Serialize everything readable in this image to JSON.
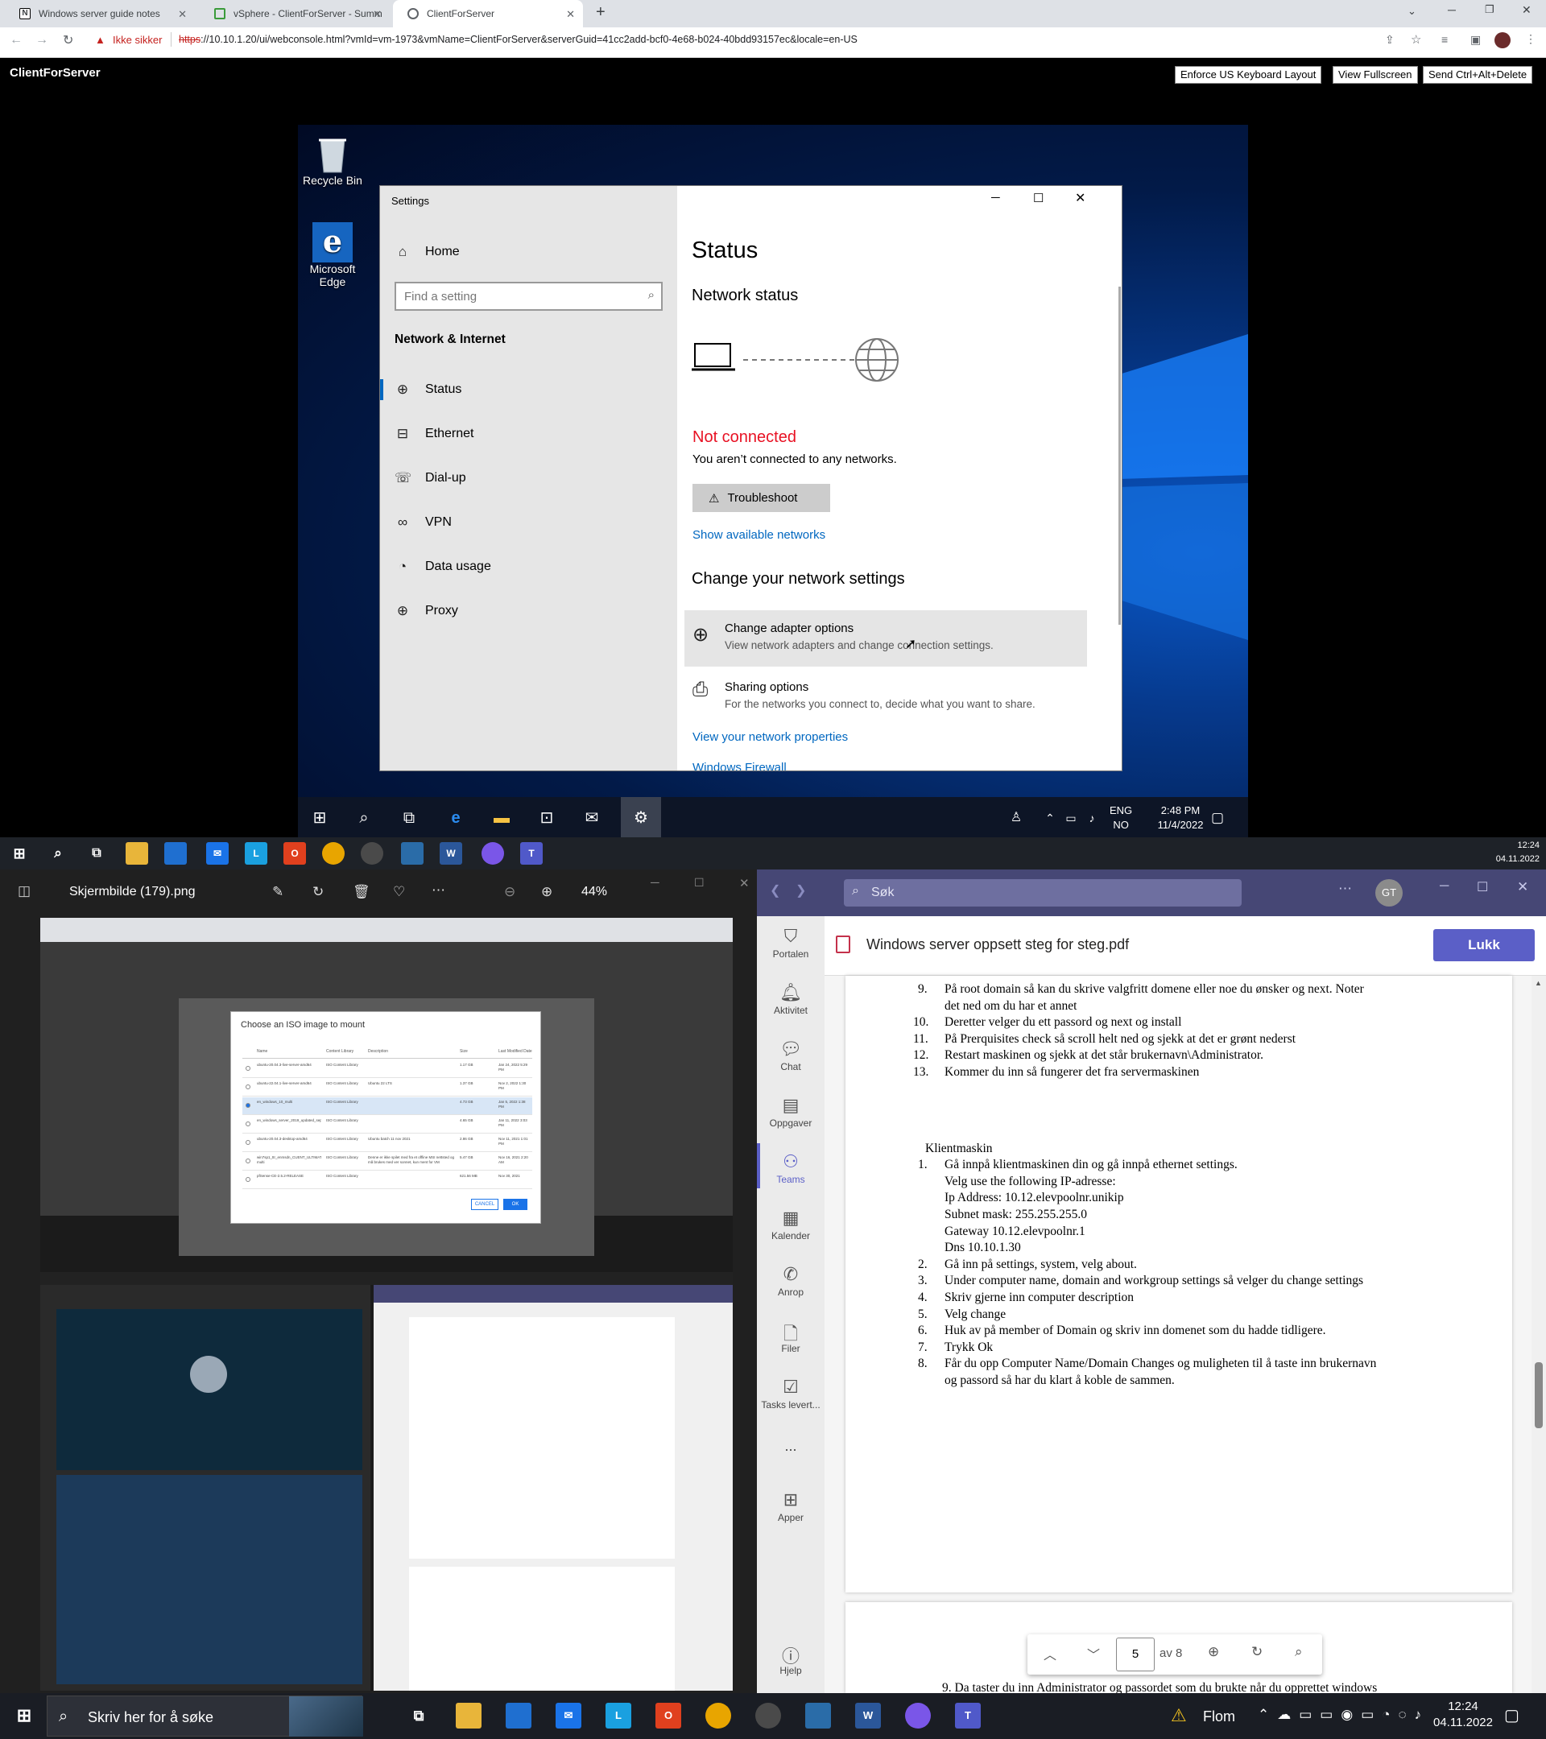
{
  "browser": {
    "tabs": [
      {
        "title": "Windows server guide notes",
        "active": false
      },
      {
        "title": "vSphere - ClientForServer - Summ",
        "active": false
      },
      {
        "title": "ClientForServer",
        "active": true
      }
    ],
    "security_label": "Ikke sikker",
    "url_scheme": "https",
    "url_rest": "://10.10.1.20/ui/webconsole.html?vmId=vm-1973&vmName=ClientForServer&serverGuid=41cc2add-bcf0-4e68-b024-40bdd93157ec&locale=en-US",
    "new_tab": "+"
  },
  "console": {
    "vm_name": "ClientForServer",
    "buttons": [
      "Enforce US Keyboard Layout",
      "View Fullscreen",
      "Send Ctrl+Alt+Delete"
    ]
  },
  "vm_desktop": {
    "icons": [
      {
        "label": "Recycle Bin",
        "icon": "recycle-bin-icon"
      },
      {
        "label": "Microsoft Edge",
        "icon": "edge-icon"
      }
    ]
  },
  "settings": {
    "window_title": "Settings",
    "home": "Home",
    "search_placeholder": "Find a setting",
    "section": "Network & Internet",
    "nav": [
      {
        "label": "Status",
        "icon": "home-globe-icon",
        "selected": true
      },
      {
        "label": "Ethernet",
        "icon": "ethernet-icon"
      },
      {
        "label": "Dial-up",
        "icon": "dialup-icon"
      },
      {
        "label": "VPN",
        "icon": "vpn-icon"
      },
      {
        "label": "Data usage",
        "icon": "data-usage-icon"
      },
      {
        "label": "Proxy",
        "icon": "globe-icon"
      }
    ],
    "page_title": "Status",
    "network_status": "Network status",
    "not_connected": "Not connected",
    "not_connected_desc": "You aren’t connected to any networks.",
    "troubleshoot": "Troubleshoot",
    "show_networks": "Show available networks",
    "change_heading": "Change your network settings",
    "options": [
      {
        "title": "Change adapter options",
        "desc": "View network adapters and change connection settings."
      },
      {
        "title": "Sharing options",
        "desc": "For the networks you connect to, decide what you want to share."
      }
    ],
    "view_properties": "View your network properties",
    "firewall": "Windows Firewall",
    "accent": "#0067c0",
    "error_color": "#e81123"
  },
  "vm_taskbar": {
    "lang1": "ENG",
    "lang2": "NO",
    "time": "2:48 PM",
    "date": "11/4/2022"
  },
  "host_top": {
    "time": "12:24",
    "date": "04.11.2022"
  },
  "photos": {
    "title": "Skjermbilde (179).png",
    "zoom": "44%",
    "iso_dialog": {
      "title": "Choose an ISO image to mount",
      "columns": [
        "Name",
        "Content Library",
        "Description",
        "Size",
        "Last Modified Date"
      ],
      "rows": [
        [
          "ubuntu-20.04.3-live-server-amd64",
          "ISO Content Library",
          "",
          "1.17 GB",
          "Jan 24, 2022 5:29 PM"
        ],
        [
          "ubuntu-22.04.1-live-server-amd64",
          "ISO Content Library",
          "Ubuntu 22 LTS",
          "1.37 GB",
          "Nov 2, 2022 1:30 PM"
        ],
        [
          "en_windows_10_multi",
          "ISO Content Library",
          "",
          "4.73 GB",
          "Jan 5, 2022 1:38 PM"
        ],
        [
          "en_windows_server_2019_updated_sept_2019_x64_dvd_199664ce",
          "ISO Content Library",
          "",
          "4.65 GB",
          "Jan 11, 2022 3:03 PM"
        ],
        [
          "ubuntu-20.04.3-desktop-amd64",
          "ISO Content Library",
          "Ubuntu batch 11 nov 2021",
          "2.86 GB",
          "Nov 11, 2021 1:01 PM"
        ],
        [
          "win7sp1_ttr_enmsdn_CUENT_ULTIMATE_x64FRE_ar-multi",
          "ISO Content Library",
          "Denne er ikke spilet med fra et offline MSI nettsted og må brukes med ver sonnet, kun ment for VM",
          "5.47 GB",
          "Nov 16, 2021 2:20 AM"
        ],
        [
          "pfSense-CE-2.5.2-RELEASE",
          "ISO Content Library",
          "",
          "621.56 MB",
          "Nov 30, 2021"
        ]
      ],
      "cancel": "CANCEL",
      "ok": "OK"
    }
  },
  "teams": {
    "search_placeholder": "Søk",
    "avatar": "GT",
    "rail": [
      "Portalen",
      "Aktivitet",
      "Chat",
      "Oppgaver",
      "Teams",
      "Kalender",
      "Anrop",
      "Filer",
      "Tasks levert...",
      "...",
      "Apper",
      "Hjelp"
    ],
    "pdf_title": "Windows server oppsett steg for steg.pdf",
    "close": "Lukk",
    "server_steps": [
      {
        "num": "9.",
        "lines": [
          "På root domain så kan du skrive valgfritt domene eller noe du ønsker og next. Noter",
          "det ned om du har et annet"
        ]
      },
      {
        "num": "10.",
        "lines": [
          "Deretter velger du ett passord og next og install"
        ]
      },
      {
        "num": "11.",
        "lines": [
          "På Prerquisites check så scroll helt ned og sjekk at det er grønt nederst"
        ]
      },
      {
        "num": "12.",
        "lines": [
          "Restart maskinen og sjekk at det står brukernavn\\Administrator."
        ]
      },
      {
        "num": "13.",
        "lines": [
          "Kommer du inn så fungerer det fra servermaskinen"
        ]
      }
    ],
    "client_heading": "Klientmaskin",
    "client_steps": [
      {
        "num": "1.",
        "lines": [
          "Gå innpå klientmaskinen din og gå innpå ethernet settings.",
          "Velg use the following IP-adresse:",
          "Ip Address: 10.12.elevpoolnr.unikip",
          "Subnet mask: 255.255.255.0",
          "Gateway 10.12.elevpoolnr.1",
          "Dns 10.10.1.30"
        ]
      },
      {
        "num": "2.",
        "lines": [
          "Gå inn på settings, system, velg about."
        ]
      },
      {
        "num": "3.",
        "lines": [
          "Under computer name, domain and workgroup settings så velger du change settings"
        ]
      },
      {
        "num": "4.",
        "lines": [
          "Skriv gjerne inn computer description"
        ]
      },
      {
        "num": "5.",
        "lines": [
          "Velg change"
        ]
      },
      {
        "num": "6.",
        "lines": [
          "Huk av på member of Domain og skriv inn domenet som du hadde tidligere."
        ]
      },
      {
        "num": "7.",
        "lines": [
          "Trykk Ok"
        ]
      },
      {
        "num": "8.",
        "lines": [
          "Får du opp Computer Name/Domain Changes og muligheten til å taste inn brukernavn",
          "og passord så har du klart å koble de sammen."
        ]
      }
    ],
    "page_current": "5",
    "page_total": "av 8",
    "next_page_text": "9.   Da taster du inn Administrator og passordet som du brukte når du opprettet windows"
  },
  "host_bottom": {
    "search_placeholder": "Skriv her for å søke",
    "weather": "Flom",
    "time": "12:24",
    "date": "04.11.2022"
  }
}
